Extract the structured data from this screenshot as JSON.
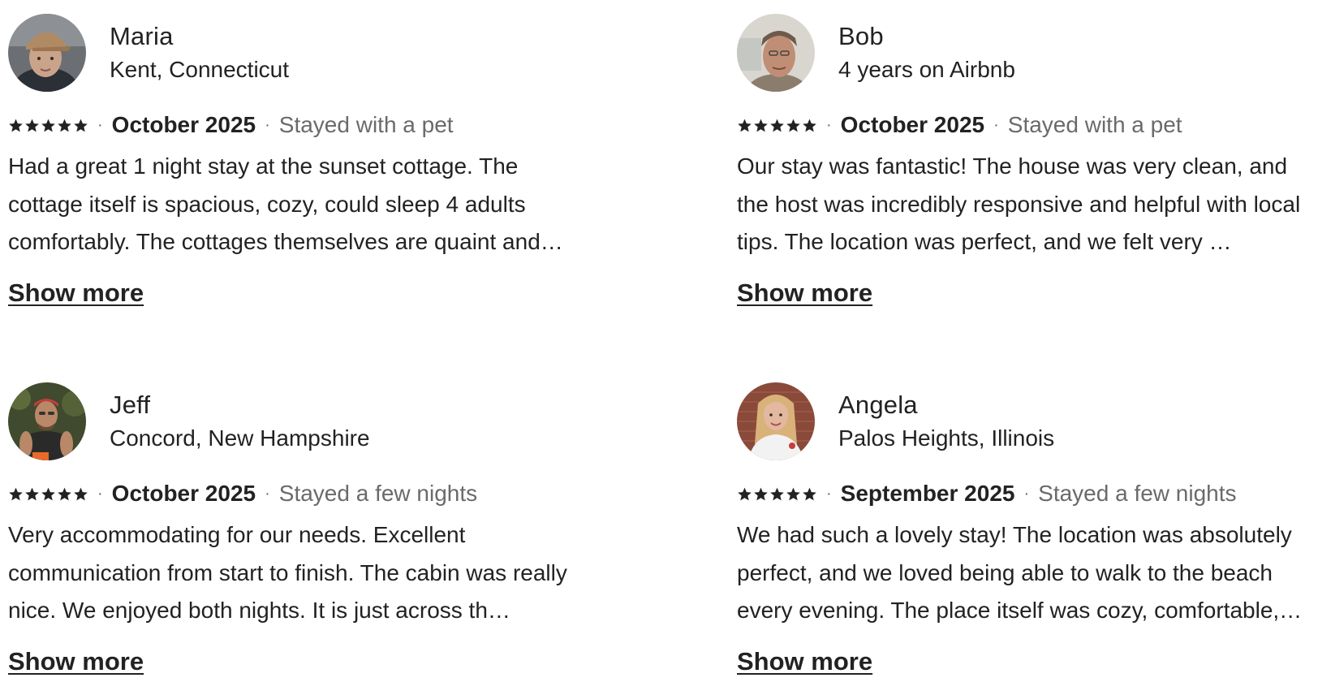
{
  "reviews": [
    {
      "name": "Maria",
      "subtitle": "Kent, Connecticut",
      "rating": 5,
      "date": "October 2025",
      "stay": "Stayed with a pet",
      "text": "Had a great 1 night stay at the sunset cottage. The cottage itself is spacious, cozy, could sleep 4 adults comfortably. The cottages themselves are quaint and…",
      "show_more": "Show more",
      "avatar_colors": {
        "bg": "#6b6f74",
        "skin": "#c9a48a",
        "hat": "#b08a62",
        "shirt": "#2b2f36"
      }
    },
    {
      "name": "Bob",
      "subtitle": "4 years on Airbnb",
      "rating": 5,
      "date": "October 2025",
      "stay": "Stayed with a pet",
      "text": "Our stay  was fantastic! The house was very clean, and the host was incredibly responsive and helpful with local tips. The location was perfect, and we felt very …",
      "show_more": "Show more",
      "avatar_colors": {
        "bg": "#d9d6cf",
        "skin": "#c08e74",
        "hair": "#6e5a4a",
        "shirt": "#8a7d6e"
      }
    },
    {
      "name": "Jeff",
      "subtitle": "Concord, New Hampshire",
      "rating": 5,
      "date": "October 2025",
      "stay": "Stayed a few nights",
      "text": "Very accommodating for our needs. Excellent communication from start to finish. The cabin was really nice. We enjoyed both nights. It is just across th…",
      "show_more": "Show more",
      "avatar_colors": {
        "bg": "#3f4a2e",
        "skin": "#b98868",
        "cap": "#c83c3c",
        "shirt": "#2a2a2a"
      }
    },
    {
      "name": "Angela",
      "subtitle": "Palos Heights, Illinois",
      "rating": 5,
      "date": "September 2025",
      "stay": "Stayed a few nights",
      "text": "We had such a lovely stay! The location was absolutely perfect, and we loved being able to walk to the beach every evening. The place itself was cozy, comfortable,…",
      "show_more": "Show more",
      "avatar_colors": {
        "bg": "#8a4a3a",
        "skin": "#e2b9a0",
        "hair": "#d9b27a",
        "shirt": "#f2f2f2"
      }
    }
  ]
}
